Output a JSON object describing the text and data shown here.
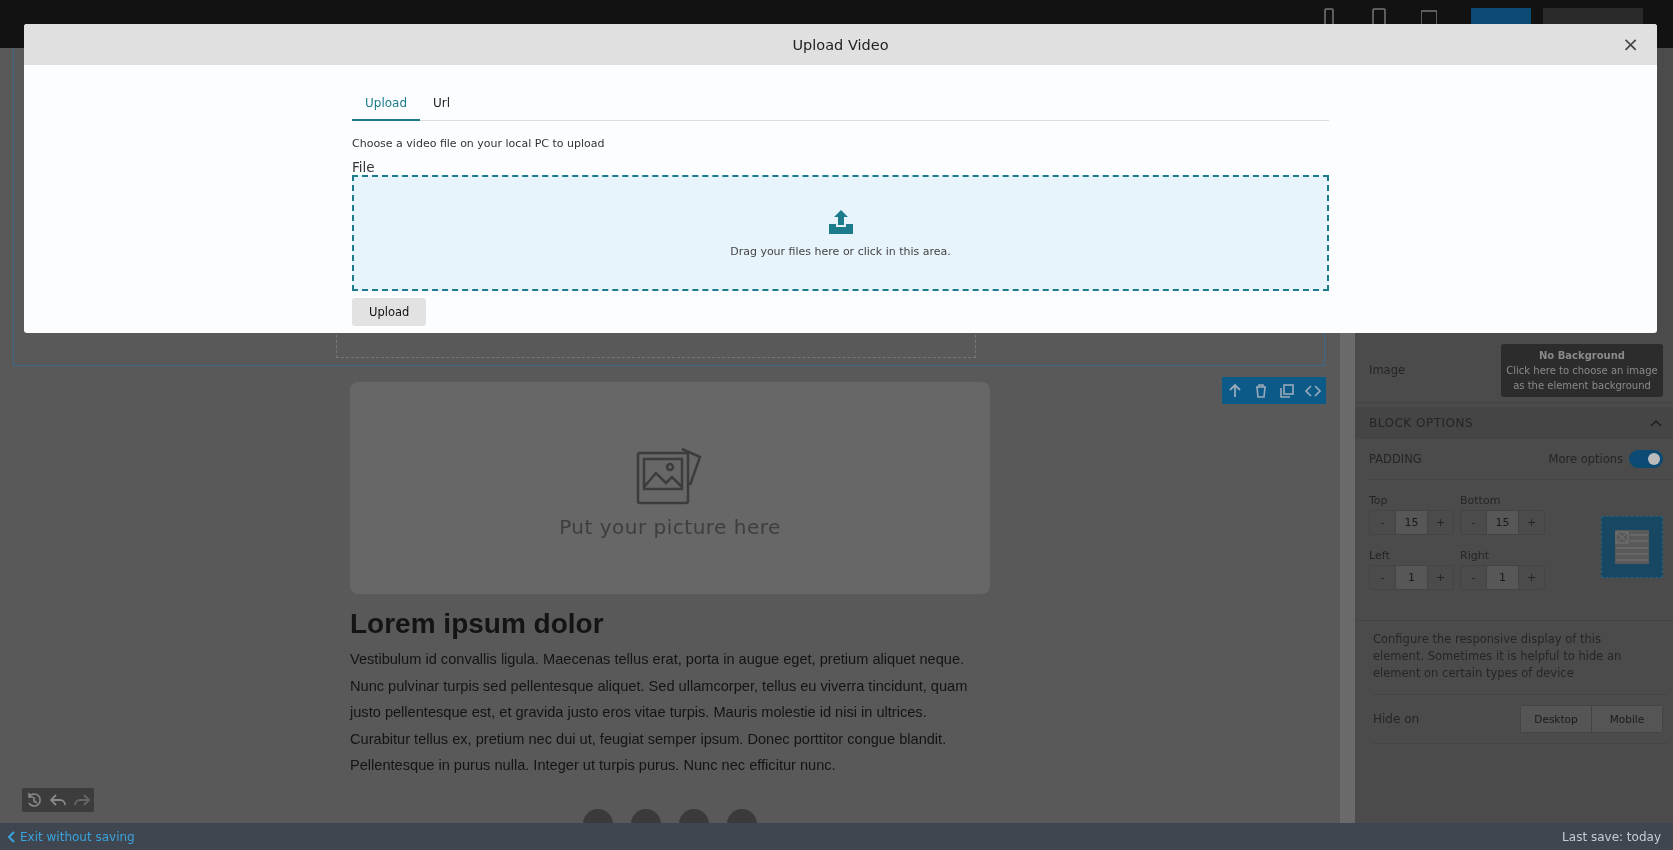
{
  "top_bar": {
    "buttons": [
      {
        "kind": "primary"
      },
      {
        "kind": "secondary"
      }
    ]
  },
  "modal": {
    "title": "Upload Video",
    "close": "×",
    "tabs": [
      {
        "label": "Upload",
        "selected": true
      },
      {
        "label": "Url",
        "selected": false
      }
    ],
    "hint": "Choose a video file on your local PC to upload",
    "file_label": "File",
    "dropzone": {
      "text": "Drag your files here or click in this area."
    },
    "button": "Upload"
  },
  "editor": {
    "image_placeholder": "Put your picture here",
    "heading": "Lorem ipsum dolor",
    "paragraph": "Vestibulum id convallis ligula. Maecenas tellus erat, porta in augue eget, pretium aliquet neque. Nunc pulvinar turpis sed pellentesque aliquet. Sed ullamcorper, tellus eu viverra tincidunt, quam justo pellentesque est, et gravida justo eros vitae turpis. Mauris molestie id nisi in ultrices. Curabitur tellus ex, pretium nec dui ut, feugiat semper ipsum. Donec porttitor congue blandit. Pellentesque in purus nulla. Integer ut turpis purus. Nunc nec efficitur nunc."
  },
  "settings": {
    "image_label": "Image",
    "background": {
      "title": "No Background",
      "hint": "Click here to choose an image as the element background"
    },
    "section": {
      "title": "BLOCK OPTIONS",
      "expanded": true
    },
    "padding": {
      "label": "PADDING",
      "more_options": {
        "label": "More options",
        "on": true
      },
      "fields": [
        {
          "label": "Top",
          "dec": "-",
          "value": "15",
          "inc": "+"
        },
        {
          "label": "Bottom",
          "dec": "-",
          "value": "15",
          "inc": "+"
        },
        {
          "label": "Left",
          "dec": "-",
          "value": "1",
          "inc": "+"
        },
        {
          "label": "Right",
          "dec": "-",
          "value": "1",
          "inc": "+"
        }
      ]
    },
    "responsive_text": "Configure the responsive display of this element. Sometimes it is helpful to hide an element on certain types of device",
    "hide_on": {
      "label": "Hide on",
      "options": [
        {
          "label": "Desktop",
          "selected": false
        },
        {
          "label": "Mobile",
          "selected": false
        }
      ]
    }
  },
  "footer": {
    "exit": "Exit without saving",
    "last_save": "Last save: today"
  }
}
